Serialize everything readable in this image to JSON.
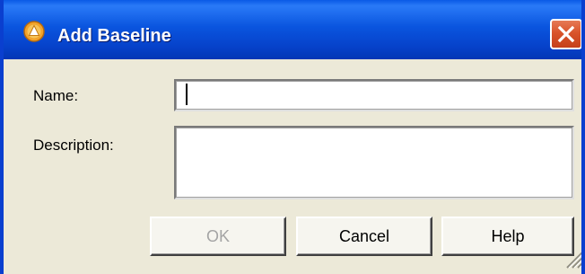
{
  "window": {
    "title": "Add Baseline",
    "icon": "app-icon-orange-circle",
    "close_icon": "close-icon"
  },
  "form": {
    "name_label": "Name:",
    "name_value": "",
    "description_label": "Description:",
    "description_value": ""
  },
  "buttons": {
    "ok": {
      "label": "OK",
      "enabled": false
    },
    "cancel": {
      "label": "Cancel",
      "enabled": true
    },
    "help": {
      "label": "Help",
      "enabled": true
    }
  },
  "colors": {
    "titlebar": "#0a55df",
    "dialog_background": "#ece9d8",
    "close_button": "#d9542b",
    "disabled_text": "#a4a4a4"
  }
}
